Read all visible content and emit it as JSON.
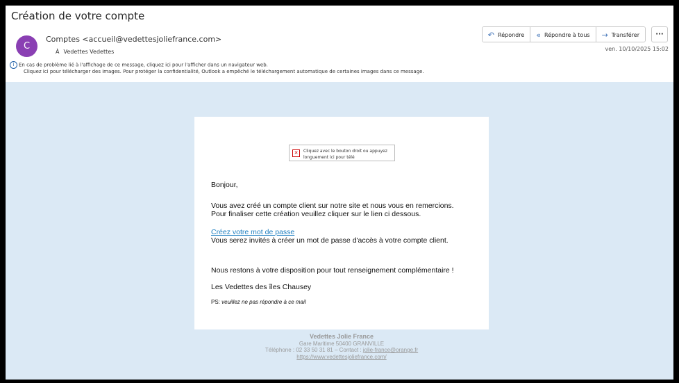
{
  "message": {
    "subject": "Création de votre compte",
    "avatar_letter": "C",
    "from": "Comptes <accueil@vedettesjoliefrance.com>",
    "to_label": "À",
    "to": "Vedettes Vedettes",
    "date": "ven. 10/10/2025 15:02",
    "avatar_color": "#8a3fb3"
  },
  "toolbar": {
    "reply": "Répondre",
    "reply_all": "Répondre à tous",
    "forward": "Transférer",
    "more": "···"
  },
  "infobar": {
    "line1": "En cas de problème lié à l'affichage de ce message, cliquez ici pour l'afficher dans un navigateur web.",
    "line2": "Cliquez ici pour télécharger des images. Pour protéger la confidentialité, Outlook a empêché le téléchargement automatique de certaines images dans ce message."
  },
  "body": {
    "image_placeholder": "Cliquez avec le bouton droit ou appuyez longuement ici pour télé",
    "greeting": "Bonjour,",
    "p1_line1": "Vous avez créé un compte client sur notre site et nous vous en remercions.",
    "p1_line2": "Pour finaliser cette création veuillez cliquer sur le lien ci dessous.",
    "link": "Créez votre mot de passe",
    "p2": "Vous serez invités à créer un mot de passe d'accès à votre compte client.",
    "p3": "Nous restons à votre disposition pour tout renseignement complémentaire !",
    "signature": "Les Vedettes des îles Chausey",
    "ps_label": "PS: ",
    "ps_text": "veuillez ne pas répondre à ce mail"
  },
  "footer": {
    "company": "Vedettes Jolie France",
    "address": "Gare Maritime 50400 GRANVILLE",
    "phone_prefix": "Téléphone : 02 33 50 31 81 – Contact : ",
    "email": "jolie-france@orange.fr",
    "website": "https://www.vedettesjoliefrance.com/"
  },
  "colors": {
    "content_bg": "#dbe9f5",
    "link": "#1f7fc0",
    "accent": "#3b6fb6"
  }
}
